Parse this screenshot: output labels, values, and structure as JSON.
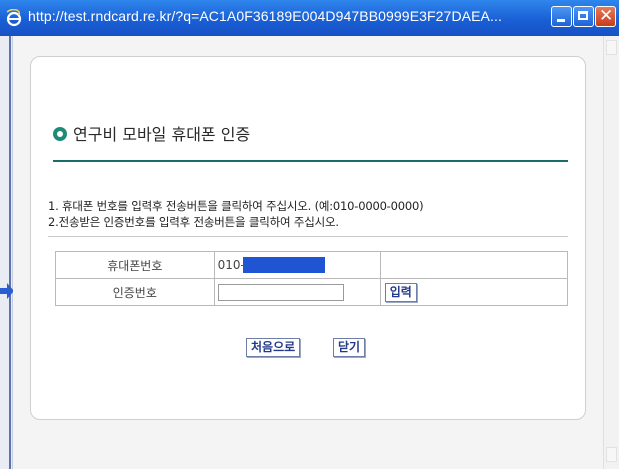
{
  "window": {
    "url": "http://test.rndcard.re.kr/?q=AC1A0F36189E004D947BB0999E3F27DAEA...",
    "icon": "internet-explorer-icon",
    "controls": [
      "minimize-icon",
      "maximize-icon",
      "close-icon"
    ]
  },
  "section": {
    "title": "연구비 모바일 휴대폰 인증",
    "instructions": [
      "1. 휴대폰 번호를 입력후 전송버튼을 클릭하여 주십시오. (예:010-0000-0000)",
      "2.전송받은 인증번호를 입력후 전송버튼을 클릭하여 주십시오."
    ]
  },
  "form": {
    "phone_label": "휴대폰번호",
    "phone_prefix": "010-",
    "auth_label": "인증번호",
    "auth_value": "",
    "submit_label": "입력"
  },
  "buttons": {
    "restart_label": "처음으로",
    "close_label": "닫기"
  },
  "colors": {
    "accent": "#1e8a78",
    "rule": "#196e68",
    "redaction": "#1f55d2",
    "titlebar": "#1a5fd6"
  }
}
